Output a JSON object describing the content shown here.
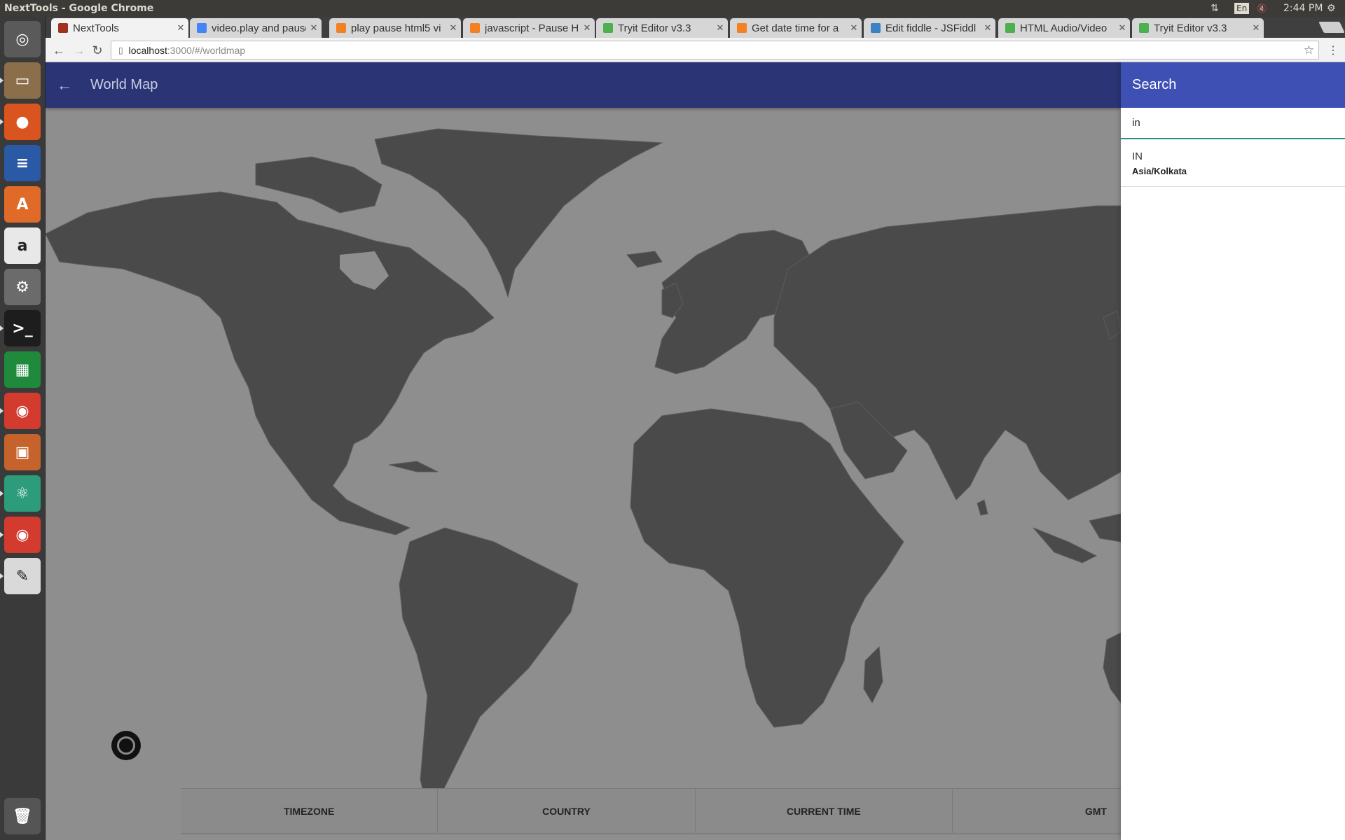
{
  "panel": {
    "window_title": "NextTools - Google Chrome",
    "net_icon": "⇅",
    "lang": "En",
    "mute_icon": "🔇",
    "time": "2:44 PM",
    "gear_icon": "⚙"
  },
  "launcher": {
    "items": [
      {
        "name": "dash-home",
        "glyph": "◎",
        "color": "#5a5a5a"
      },
      {
        "name": "files",
        "glyph": "▭",
        "color": "#8a6f4a"
      },
      {
        "name": "firefox",
        "glyph": "●",
        "color": "#d9541e"
      },
      {
        "name": "libreoffice-writer",
        "glyph": "≡",
        "color": "#2a5aa5"
      },
      {
        "name": "software-center",
        "glyph": "A",
        "color": "#e06a28"
      },
      {
        "name": "amazon",
        "glyph": "a",
        "color": "#e8e8e8"
      },
      {
        "name": "system-settings",
        "glyph": "⚙",
        "color": "#6b6b6b"
      },
      {
        "name": "terminal",
        "glyph": ">_",
        "color": "#1d1d1d"
      },
      {
        "name": "libreoffice-calc",
        "glyph": "▦",
        "color": "#1f8a3c"
      },
      {
        "name": "chrome",
        "glyph": "◉",
        "color": "#d33b2f"
      },
      {
        "name": "libreoffice-impress",
        "glyph": "▣",
        "color": "#c6632c"
      },
      {
        "name": "atom",
        "glyph": "⚛",
        "color": "#2c9c7a"
      },
      {
        "name": "chrome-2",
        "glyph": "◉",
        "color": "#d33b2f"
      },
      {
        "name": "text-editor",
        "glyph": "✎",
        "color": "#d9d9d9"
      },
      {
        "name": "trash",
        "glyph": "🗑",
        "color": "#555555"
      }
    ]
  },
  "tabs": [
    {
      "label": "NextTools",
      "fav": "#a03020",
      "active": true
    },
    {
      "label": "video.play and pause",
      "fav": "#4285f4",
      "active": false
    },
    {
      "label": "play pause html5 vi",
      "fav": "#f48024",
      "active": false
    },
    {
      "label": "javascript - Pause H",
      "fav": "#f48024",
      "active": false
    },
    {
      "label": "Tryit Editor v3.3",
      "fav": "#4caf50",
      "active": false
    },
    {
      "label": "Get date time for a",
      "fav": "#f48024",
      "active": false
    },
    {
      "label": "Edit fiddle - JSFiddl",
      "fav": "#3b82c4",
      "active": false
    },
    {
      "label": "HTML Audio/Video",
      "fav": "#4caf50",
      "active": false
    },
    {
      "label": "Tryit Editor v3.3",
      "fav": "#4caf50",
      "active": false
    }
  ],
  "toolbar": {
    "back_icon": "←",
    "forward_icon": "→",
    "reload_icon": "↻",
    "url_host": "localhost",
    "url_rest": ":3000/#/worldmap",
    "star_icon": "☆",
    "menu_icon": "⋮"
  },
  "app": {
    "back_icon": "←",
    "title": "World Map",
    "table_headers": [
      "TIMEZONE",
      "COUNTRY",
      "CURRENT TIME",
      "GMT"
    ]
  },
  "search": {
    "title": "Search",
    "query": "in",
    "results": [
      {
        "code": "IN",
        "timezone": "Asia/Kolkata"
      }
    ]
  },
  "colors": {
    "appbar": "#2b3576",
    "search_header": "#3e50b4",
    "map_bg": "#8e8e8e",
    "land": "#4a4a4a"
  }
}
